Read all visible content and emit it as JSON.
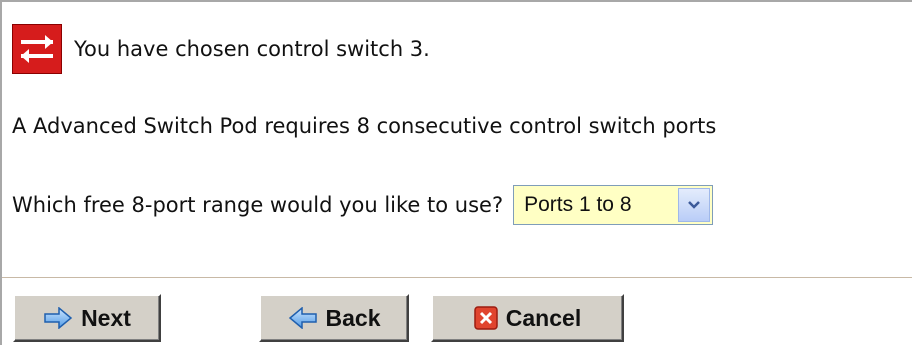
{
  "message": {
    "chosen_switch": "You have chosen control switch 3.",
    "requirement": "A Advanced Switch Pod requires 8 consecutive control switch ports",
    "question": "Which free 8-port range would you like to use?"
  },
  "port_range_select": {
    "selected": "Ports 1 to 8"
  },
  "buttons": {
    "next": "Next",
    "back": "Back",
    "cancel": "Cancel"
  },
  "icons": {
    "switch": "switch-arrows-icon",
    "next": "arrow-right-icon",
    "back": "arrow-left-icon",
    "cancel": "close-x-icon",
    "dropdown": "chevron-down-icon"
  },
  "colors": {
    "switch_icon_bg": "#d61c1c",
    "select_bg": "#ffffc4",
    "button_face": "#d4d0c8"
  }
}
